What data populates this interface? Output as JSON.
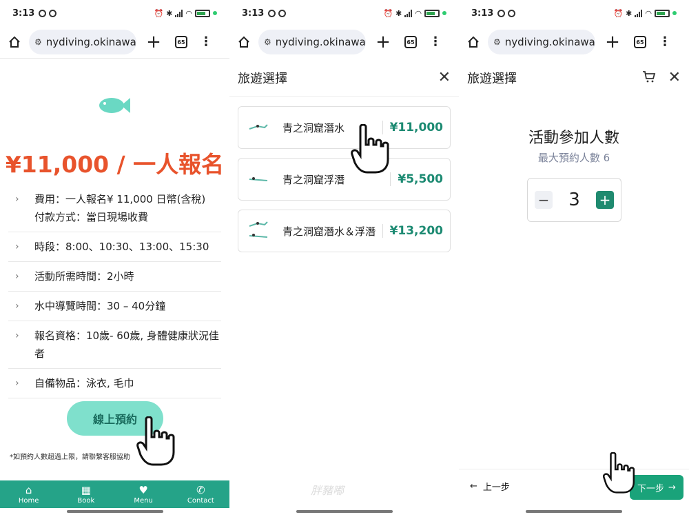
{
  "status": {
    "time": "3:13"
  },
  "browser": {
    "url": "nydiving.okinawa",
    "tab_count": "65"
  },
  "panel1": {
    "price_head": "¥11,000 / 一人報名",
    "info_items": [
      {
        "text": "費用：一人報名¥ 11,000 日幣(含稅)\n付款方式：當日現場收費"
      },
      {
        "text": "時段：8:00、10:30、13:00、15:30"
      },
      {
        "text": "活動所需時間：2小時"
      },
      {
        "text": "水中導覽時間：30 – 40分鐘"
      },
      {
        "text": "報名資格：10歲- 60歲, 身體健康狀況佳者"
      },
      {
        "text": "自備物品：泳衣, 毛巾"
      }
    ],
    "book_button": "線上預約",
    "note": "*如預約人數超過上限，請聯繫客服協助",
    "nav": [
      {
        "label": "Home",
        "icon": "home-icon"
      },
      {
        "label": "Book",
        "icon": "calendar-icon"
      },
      {
        "label": "Menu",
        "icon": "heart-icon"
      },
      {
        "label": "Contact",
        "icon": "phone-icon"
      }
    ]
  },
  "panel2": {
    "title": "旅遊選擇",
    "tours": [
      {
        "name": "青之洞窟潛水",
        "price": "¥11,000"
      },
      {
        "name": "青之洞窟浮潛",
        "price": "¥5,500"
      },
      {
        "name": "青之洞窟潛水＆浮潛",
        "price": "¥13,200"
      }
    ],
    "watermark": "胖豬嘟"
  },
  "panel3": {
    "title": "旅遊選擇",
    "people_title": "活動參加人數",
    "people_sub": "最大預約人數 6",
    "quantity": "3",
    "prev_label": "上一步",
    "next_label": "下一步"
  },
  "colors": {
    "price_orange": "#e8532c",
    "brand_green": "#25a388",
    "price_green": "#1c8a72",
    "book_button": "#7fe0cc"
  }
}
